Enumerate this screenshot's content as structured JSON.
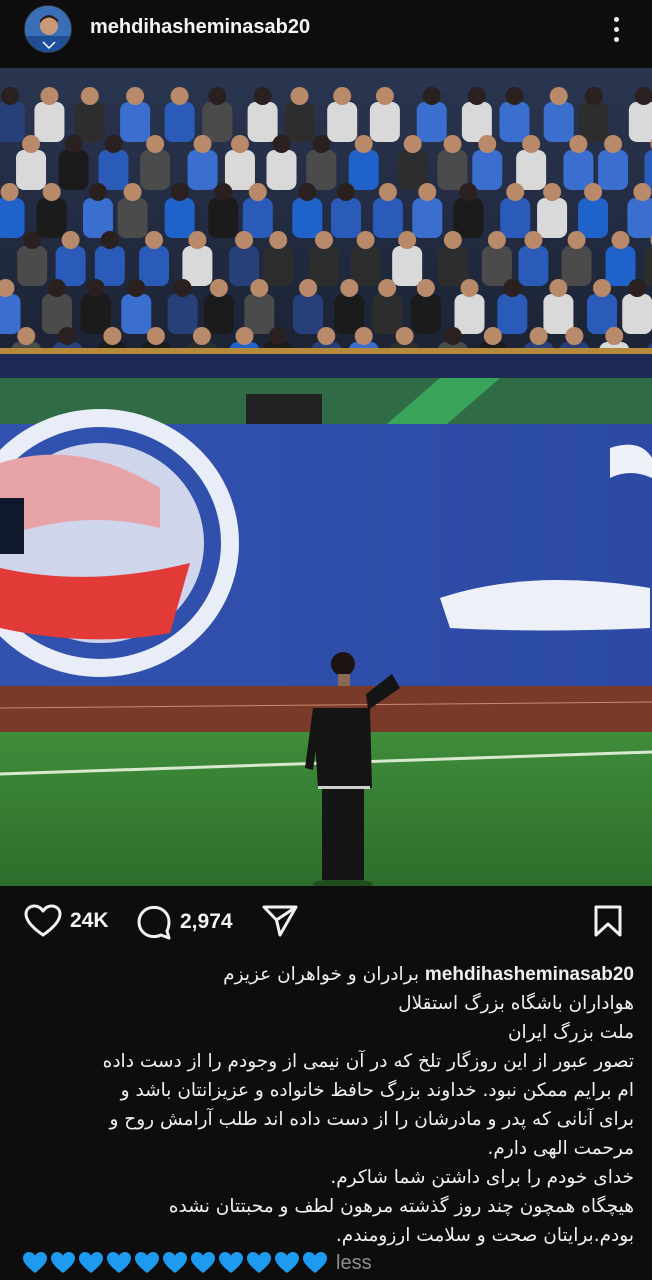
{
  "post": {
    "username": "mehdihasheminasab20",
    "menu_icon": "more-vertical-icon"
  },
  "actions": {
    "like_icon": "heart-outline-icon",
    "likes": "24K",
    "comment_icon": "comment-icon",
    "comments": "2,974",
    "share_icon": "send-icon",
    "save_icon": "bookmark-icon"
  },
  "caption": {
    "username": "mehdihasheminasab20",
    "first_line": "برادران و خواهران عزیزم",
    "lines": [
      "هواداران باشگاه بزرگ استقلال",
      "ملت بزرگ ایران",
      "تصور عبور از این روزگار تلخ که در آن نیمی از وجودم را از دست داده",
      "ام برایم ممکن نبود. خداوند بزرگ حافظ خانواده و عزیزانتان باشد و",
      "برای آنانی که پدر و مادرشان را از دست  داده اند  طلب آرامش روح و",
      "مرحمت الهی دارم.",
      "خدای خودم را برای داشتن شما شاکرم.",
      "هیچگاه همچون چند روز گذشته مرهون لطف و محبتتان نشده",
      "بودم.برایتان صحت و سلامت ارزومندم."
    ],
    "heart_count": 11,
    "heart_color": "#1e9bf0",
    "less_label": "less"
  },
  "photo": {
    "description_icon": "stadium-photo"
  }
}
